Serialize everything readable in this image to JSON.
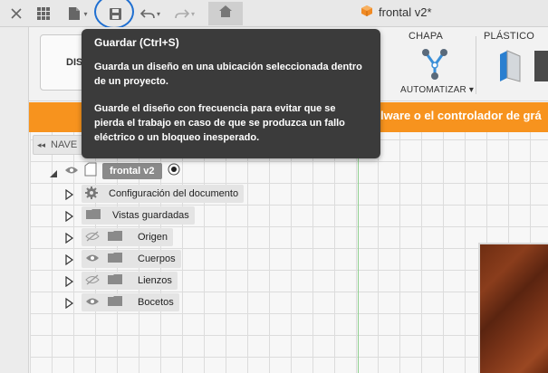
{
  "topbar": {
    "document_title": "frontal v2*",
    "icons": [
      "close-icon",
      "grid-icon",
      "file-icon",
      "save-icon",
      "undo-icon",
      "redo-icon",
      "home-icon"
    ]
  },
  "ribbon": {
    "workspace_label": "DIS",
    "chapa_label": "CHAPA",
    "plastico_label": "PLÁSTICO",
    "automatizar_label": "AUTOMATIZAR ▾"
  },
  "banner": {
    "text": "lware o el controlador de grá",
    "color": "#f7931e"
  },
  "tooltip": {
    "title": "Guardar (Ctrl+S)",
    "paragraph1": "Guarda un diseño en una ubicación seleccionada dentro de un proyecto.",
    "paragraph2": "Guarde el diseño con frecuencia para evitar que se pierda el trabajo en caso de que se produzca un fallo eléctrico o un bloqueo inesperado."
  },
  "browser": {
    "header_label": "NAVE",
    "root": "frontal v2",
    "items": [
      {
        "label": "Configuración del documento",
        "icon": "gear-icon",
        "eye": "none"
      },
      {
        "label": "Vistas guardadas",
        "icon": "folder-icon",
        "eye": "none"
      },
      {
        "label": "Origen",
        "icon": "folder-icon",
        "eye": "hidden"
      },
      {
        "label": "Cuerpos",
        "icon": "folder-icon",
        "eye": "visible"
      },
      {
        "label": "Lienzos",
        "icon": "folder-icon",
        "eye": "hidden"
      },
      {
        "label": "Bocetos",
        "icon": "folder-icon",
        "eye": "visible"
      }
    ]
  }
}
